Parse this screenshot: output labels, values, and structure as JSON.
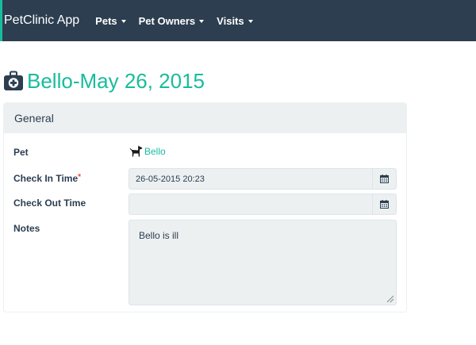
{
  "navbar": {
    "brand": "PetClinic App",
    "items": [
      {
        "label": "Pets"
      },
      {
        "label": "Pet Owners"
      },
      {
        "label": "Visits"
      }
    ]
  },
  "page": {
    "title": "Bello-May 26, 2015",
    "title_icon": "medkit-icon"
  },
  "panel": {
    "heading": "General",
    "fields": {
      "pet": {
        "label": "Pet",
        "value": "Bello",
        "icon": "dog-icon"
      },
      "check_in": {
        "label": "Check In Time",
        "required_mark": "*",
        "value": "26-05-2015 20:23",
        "icon": "calendar-icon"
      },
      "check_out": {
        "label": "Check Out Time",
        "value": "",
        "icon": "calendar-icon"
      },
      "notes": {
        "label": "Notes",
        "value": "Bello is ill"
      }
    }
  },
  "colors": {
    "navbar_bg": "#2c3e50",
    "accent": "#18bc9c",
    "input_bg": "#ecf0f1",
    "required": "#e74c3c"
  }
}
